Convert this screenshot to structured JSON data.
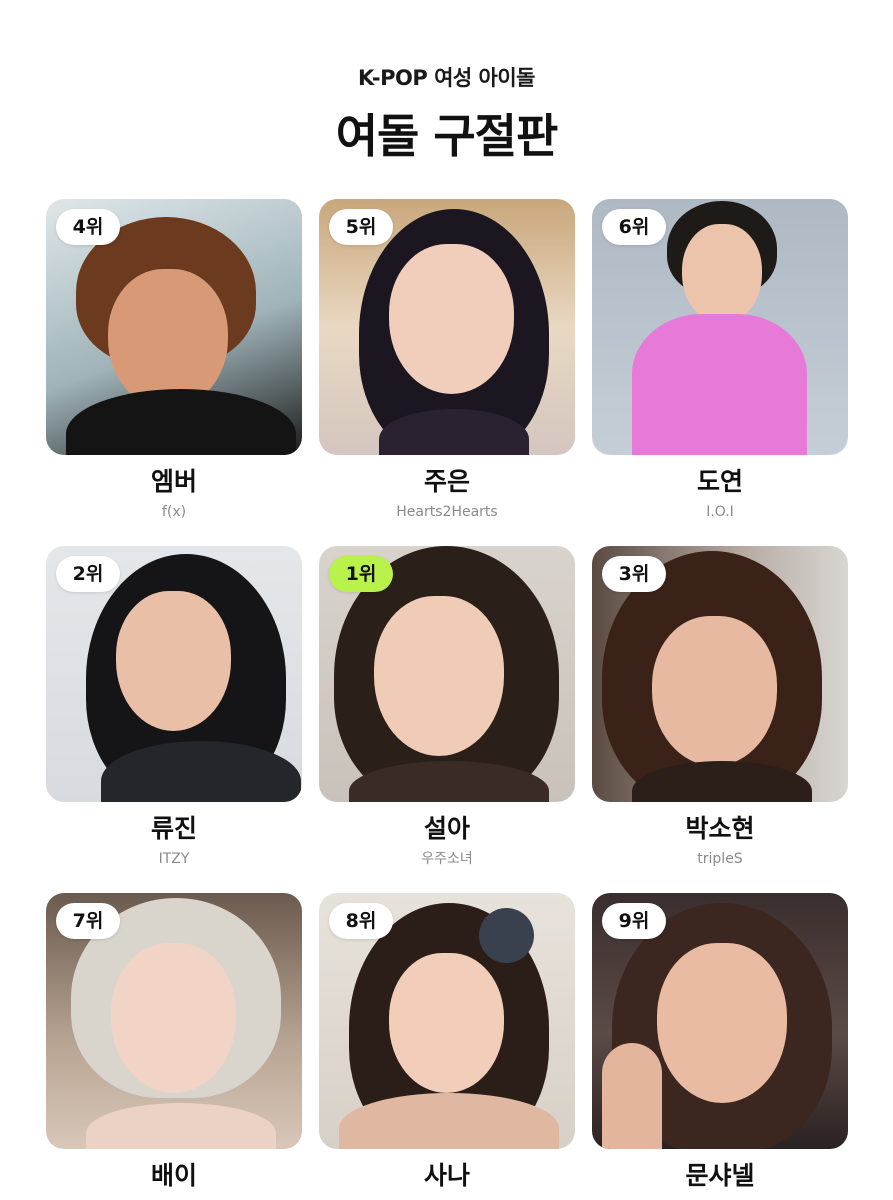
{
  "header": {
    "subtitle": "K-POP 여성 아이돌",
    "title": "여돌 구절판"
  },
  "cards": [
    {
      "rank": "4위",
      "name": "엠버",
      "group": "f(x)",
      "is_top": false
    },
    {
      "rank": "5위",
      "name": "주은",
      "group": "Hearts2Hearts",
      "is_top": false
    },
    {
      "rank": "6위",
      "name": "도연",
      "group": "I.O.I",
      "is_top": false
    },
    {
      "rank": "2위",
      "name": "류진",
      "group": "ITZY",
      "is_top": false
    },
    {
      "rank": "1위",
      "name": "설아",
      "group": "우주소녀",
      "is_top": true
    },
    {
      "rank": "3위",
      "name": "박소현",
      "group": "tripleS",
      "is_top": false
    },
    {
      "rank": "7위",
      "name": "배이",
      "group": "",
      "is_top": false
    },
    {
      "rank": "8위",
      "name": "사나",
      "group": "",
      "is_top": false
    },
    {
      "rank": "9위",
      "name": "문샤넬",
      "group": "",
      "is_top": false
    }
  ],
  "colors": {
    "top_badge": "#b9f24a",
    "badge": "#ffffff",
    "group_text": "#8a8a8a"
  }
}
